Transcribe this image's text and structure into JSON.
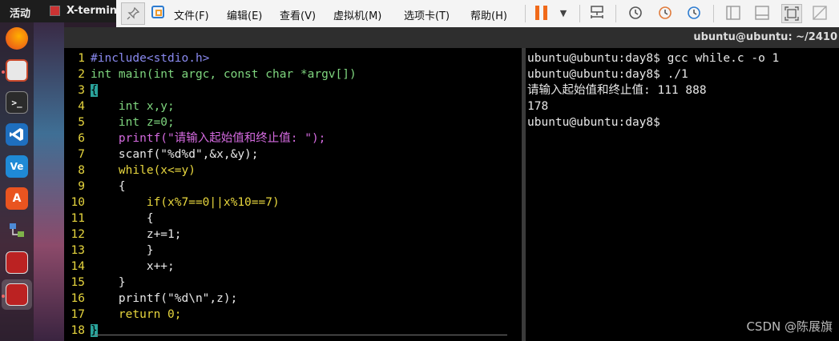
{
  "topbar": {
    "activities": "活动",
    "app_name": "X-termin"
  },
  "vmware": {
    "menus": [
      "文件(F)",
      "编辑(E)",
      "查看(V)",
      "虚拟机(M)",
      "选项卡(T)",
      "帮助(H)"
    ]
  },
  "window": {
    "title": "ubuntu@ubuntu: ~/2410"
  },
  "editor": {
    "lines": [
      {
        "n": "1",
        "text": "#include<stdio.h>"
      },
      {
        "n": "2",
        "text": "int main(int argc, const char *argv[])"
      },
      {
        "n": "3",
        "text": "{"
      },
      {
        "n": "4",
        "text": "    int x,y;"
      },
      {
        "n": "5",
        "text": "    int z=0;"
      },
      {
        "n": "6",
        "text": "    printf(\"请输入起始值和终止值: \");"
      },
      {
        "n": "7",
        "text": "    scanf(\"%d%d\",&x,&y);"
      },
      {
        "n": "8",
        "text": "    while(x<=y)"
      },
      {
        "n": "9",
        "text": "    {"
      },
      {
        "n": "10",
        "text": "        if(x%7==0||x%10==7)"
      },
      {
        "n": "11",
        "text": "        {"
      },
      {
        "n": "12",
        "text": "        z+=1;"
      },
      {
        "n": "13",
        "text": "        }"
      },
      {
        "n": "14",
        "text": "        x++;"
      },
      {
        "n": "15",
        "text": "    }"
      },
      {
        "n": "16",
        "text": "    printf(\"%d\\n\",z);"
      },
      {
        "n": "17",
        "text": "    return 0;"
      },
      {
        "n": "18",
        "text": "}"
      }
    ]
  },
  "terminal": {
    "lines": [
      "ubuntu@ubuntu:day8$ gcc while.c -o 1",
      "ubuntu@ubuntu:day8$ ./1",
      "请输入起始值和终止值: 111 888",
      "178",
      "ubuntu@ubuntu:day8$"
    ]
  },
  "watermark": "CSDN @陈展旗",
  "colors": {
    "line_number": "#e7d63e",
    "keyword": "#e7d63e",
    "type": "#7fd67f",
    "string": "#d46adf",
    "preprocessor": "#8a8af0",
    "cursor": "#2aa39b"
  }
}
